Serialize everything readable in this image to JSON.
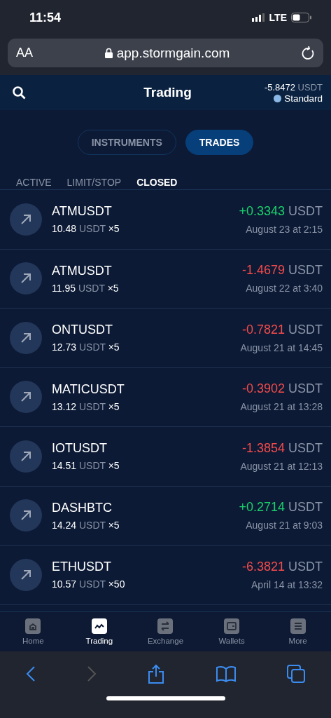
{
  "status_bar": {
    "time": "11:54",
    "network": "LTE"
  },
  "browser": {
    "text_size": "AA",
    "url": "app.stormgain.com"
  },
  "header": {
    "title": "Trading",
    "balance": "-5.8472",
    "balance_unit": "USDT",
    "account": {
      "label": "Standard",
      "color": "#8ab8e6"
    }
  },
  "segments": [
    {
      "label": "INSTRUMENTS",
      "selected": false
    },
    {
      "label": "TRADES",
      "selected": true
    }
  ],
  "tabs": [
    {
      "label": "ACTIVE",
      "selected": false
    },
    {
      "label": "LIMIT/STOP",
      "selected": false
    },
    {
      "label": "CLOSED",
      "selected": true
    }
  ],
  "trades": [
    {
      "symbol": "ATMUSDT",
      "amount": "10.48",
      "unit": "USDT",
      "multiplier": "×5",
      "kind": "profit",
      "pnl": "+0.3343",
      "pnl_unit": "USDT",
      "date": "August 23 at 2:15"
    },
    {
      "symbol": "ATMUSDT",
      "amount": "11.95",
      "unit": "USDT",
      "multiplier": "×5",
      "kind": "loss",
      "pnl": "-1.4679",
      "pnl_unit": "USDT",
      "date": "August 22 at 3:40"
    },
    {
      "symbol": "ONTUSDT",
      "amount": "12.73",
      "unit": "USDT",
      "multiplier": "×5",
      "kind": "loss",
      "pnl": "-0.7821",
      "pnl_unit": "USDT",
      "date": "August 21 at 14:45"
    },
    {
      "symbol": "MATICUSDT",
      "amount": "13.12",
      "unit": "USDT",
      "multiplier": "×5",
      "kind": "loss",
      "pnl": "-0.3902",
      "pnl_unit": "USDT",
      "date": "August 21 at 13:28"
    },
    {
      "symbol": "IOTUSDT",
      "amount": "14.51",
      "unit": "USDT",
      "multiplier": "×5",
      "kind": "loss",
      "pnl": "-1.3854",
      "pnl_unit": "USDT",
      "date": "August 21 at 12:13"
    },
    {
      "symbol": "DASHBTC",
      "amount": "14.24",
      "unit": "USDT",
      "multiplier": "×5",
      "kind": "profit",
      "pnl": "+0.2714",
      "pnl_unit": "USDT",
      "date": "August 21 at 9:03"
    },
    {
      "symbol": "ETHUSDT",
      "amount": "10.57",
      "unit": "USDT",
      "multiplier": "×50",
      "kind": "loss",
      "pnl": "-6.3821",
      "pnl_unit": "USDT",
      "date": "April 14 at 13:32"
    }
  ],
  "nav": [
    {
      "kind": "home",
      "label": "Home",
      "selected": false
    },
    {
      "kind": "trading",
      "label": "Trading",
      "selected": true
    },
    {
      "kind": "exchange",
      "label": "Exchange",
      "selected": false
    },
    {
      "kind": "wallets",
      "label": "Wallets",
      "selected": false
    },
    {
      "kind": "more",
      "label": "More",
      "selected": false
    }
  ],
  "browser_toolbar": {
    "back_disabled": false,
    "forward_disabled": true
  }
}
